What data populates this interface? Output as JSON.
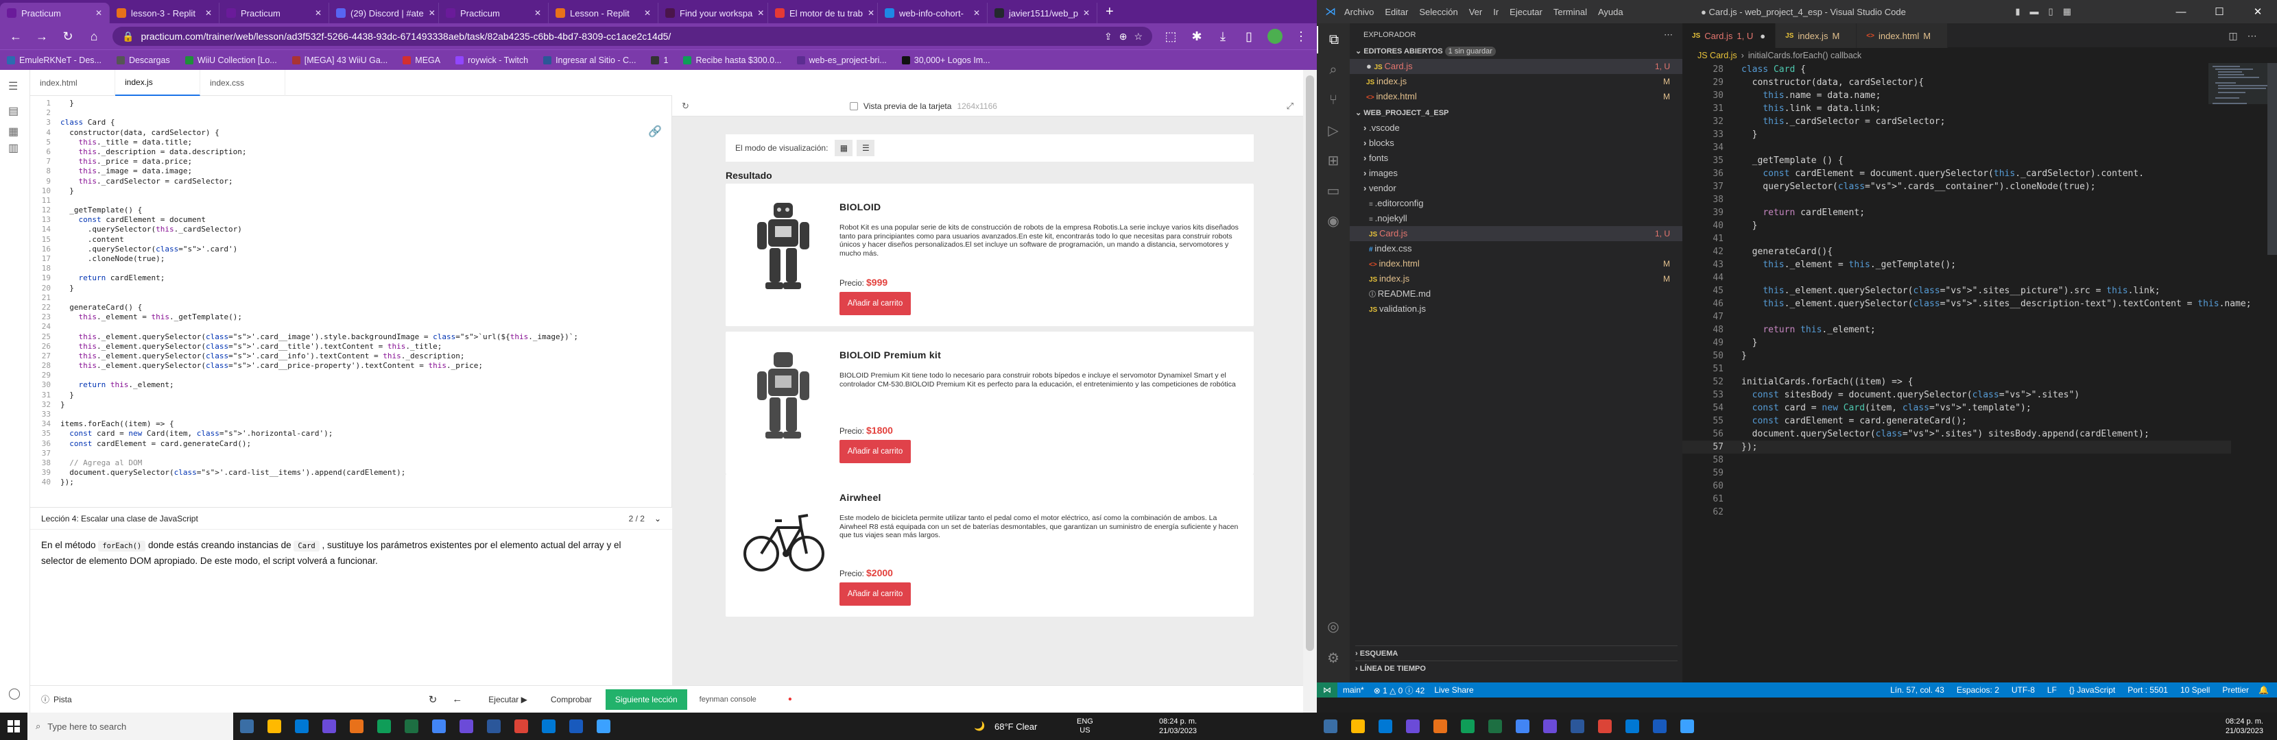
{
  "browser": {
    "tabs": [
      "Practicum",
      "lesson-3 - Replit",
      "Practicum",
      "(29) Discord | #ate",
      "Practicum",
      "Lesson - Replit",
      "Find your workspa",
      "El motor de tu trab",
      "web-info-cohort-",
      "javier1511/web_p"
    ],
    "new_tab": "+",
    "url": "practicum.com/trainer/web/lesson/ad3f532f-5266-4438-93dc-671493338aeb/task/82ab4235-c6bb-4bd7-8309-cc1ace2c14d5/",
    "bookmarks": [
      "EmuleRKNeT - Des...",
      "Descargas",
      "WiiU Collection [Lo...",
      "[MEGA] 43 WiiU Ga...",
      "MEGA",
      "roywick - Twitch",
      "Ingresar al Sitio - C...",
      "1",
      "Recibe hasta $300.0...",
      "web-es_project-bri...",
      "30,000+ Logos Im..."
    ],
    "bm_colors": [
      "#2c6bb0",
      "#555",
      "#1f8f3a",
      "#a33",
      "#d32f2f",
      "#9146ff",
      "#2b5797",
      "#333",
      "#0f9d58",
      "#5c2d91",
      "#111"
    ]
  },
  "practicum": {
    "editor_tabs": [
      "index.html",
      "index.js",
      "index.css"
    ],
    "code": [
      {
        "n": "",
        "t": "  }"
      },
      {
        "n": "",
        "t": ""
      },
      {
        "n": "",
        "t": "class Card {"
      },
      {
        "n": "",
        "t": "  constructor(data, cardSelector) {"
      },
      {
        "n": "",
        "t": "    this._title = data.title;"
      },
      {
        "n": "",
        "t": "    this._description = data.description;"
      },
      {
        "n": "",
        "t": "    this._price = data.price;"
      },
      {
        "n": "",
        "t": "    this._image = data.image;"
      },
      {
        "n": "",
        "t": "    this._cardSelector = cardSelector;"
      },
      {
        "n": "",
        "t": "  }"
      },
      {
        "n": "",
        "t": ""
      },
      {
        "n": "",
        "t": "  _getTemplate() {"
      },
      {
        "n": "",
        "t": "    const cardElement = document"
      },
      {
        "n": "",
        "t": "      .querySelector(this._cardSelector)"
      },
      {
        "n": "",
        "t": "      .content"
      },
      {
        "n": "",
        "t": "      .querySelector('.card')"
      },
      {
        "n": "",
        "t": "      .cloneNode(true);"
      },
      {
        "n": "",
        "t": ""
      },
      {
        "n": "",
        "t": "    return cardElement;"
      },
      {
        "n": "",
        "t": "  }"
      },
      {
        "n": "",
        "t": ""
      },
      {
        "n": "",
        "t": "  generateCard() {"
      },
      {
        "n": "",
        "t": "    this._element = this._getTemplate();"
      },
      {
        "n": "",
        "t": ""
      },
      {
        "n": "",
        "t": "    this._element.querySelector('.card__image').style.backgroundImage = `url(${this._image})`;"
      },
      {
        "n": "",
        "t": "    this._element.querySelector('.card__title').textContent = this._title;"
      },
      {
        "n": "",
        "t": "    this._element.querySelector('.card__info').textContent = this._description;"
      },
      {
        "n": "",
        "t": "    this._element.querySelector('.card__price-property').textContent = this._price;"
      },
      {
        "n": "",
        "t": ""
      },
      {
        "n": "",
        "t": "    return this._element;"
      },
      {
        "n": "",
        "t": "  }"
      },
      {
        "n": "",
        "t": "}"
      },
      {
        "n": "",
        "t": ""
      },
      {
        "n": "",
        "t": "items.forEach((item) => {"
      },
      {
        "n": "",
        "t": "  const card = new Card(item, '.horizontal-card');"
      },
      {
        "n": "",
        "t": "  const cardElement = card.generateCard();"
      },
      {
        "n": "",
        "t": ""
      },
      {
        "n": "",
        "t": "  // Agrega al DOM"
      },
      {
        "n": "",
        "t": "  document.querySelector('.card-list__items').append(cardElement);"
      },
      {
        "n": "",
        "t": "});"
      }
    ],
    "lesson_title": "Lección 4: Escalar una clase de JavaScript",
    "lesson_pager": "2 / 2",
    "lesson_text_1": "En el método",
    "lesson_code_1": "forEach()",
    "lesson_text_2": "donde estás creando instancias de",
    "lesson_code_2": "Card",
    "lesson_text_3": ", sustituye los parámetros existentes por el elemento actual del array y el selector de elemento DOM apropiado. De este modo, el script volverá a funcionar.",
    "preview_label": "Vista previa de la tarjeta",
    "preview_size": "1264x1166",
    "view_mode_label": "El modo de visualización:",
    "result_label": "Resultado",
    "cards": [
      {
        "title": "BIOLOID",
        "desc": "Robot Kit es una popular serie de kits de construcción de robots de la empresa Robotis.La serie incluye varios kits diseñados tanto para principiantes como para usuarios avanzados.En este kit, encontrarás todo lo que necesitas para construir robots únicos y hacer diseños personalizados.El set incluye un software de programación, un mando a distancia, servomotores y mucho más.",
        "price_label": "Precio:",
        "price": "$999",
        "button": "Añadir al carrito"
      },
      {
        "title": "BIOLOID Premium kit",
        "desc": "BIOLOID Premium Kit tiene todo lo necesario para construir robots bípedos e incluye el servomotor Dynamixel Smart y el controlador CM-530.BIOLOID Premium Kit es perfecto para la educación, el entretenimiento y las competiciones de robótica",
        "price_label": "Precio:",
        "price": "$1800",
        "button": "Añadir al carrito"
      },
      {
        "title": "Airwheel",
        "desc": "Este modelo de bicicleta permite utilizar tanto el pedal como el motor eléctrico, así como la combinación de ambos. La Airwheel R8 está equipada con un set de baterías desmontables, que garantizan un suministro de energía suficiente y hacen que tus viajes sean más largos.",
        "price_label": "Precio:",
        "price": "$2000",
        "button": "Añadir al carrito"
      }
    ],
    "bottom": {
      "hint": "Pista",
      "run": "Ejecutar",
      "check": "Comprobar",
      "next": "Siguiente lección",
      "feynman": "feynman console"
    }
  },
  "vscode": {
    "title": "● Card.js - web_project_4_esp - Visual Studio Code",
    "menu": [
      "Archivo",
      "Editar",
      "Selección",
      "Ver",
      "Ir",
      "Ejecutar",
      "Terminal",
      "Ayuda"
    ],
    "explorer_title": "EXPLORADOR",
    "open_editors": "EDITORES ABIERTOS",
    "unsaved": "1 sin guardar",
    "open_files": [
      {
        "name": "Card.js",
        "badge": "1, U"
      },
      {
        "name": "index.js",
        "badge": "M"
      },
      {
        "name": "index.html",
        "badge": "M"
      }
    ],
    "project": "WEB_PROJECT_4_ESP",
    "tree": [
      {
        "name": ".vscode",
        "badge": "",
        "folder": true
      },
      {
        "name": "blocks",
        "badge": "",
        "folder": true
      },
      {
        "name": "fonts",
        "badge": "",
        "folder": true
      },
      {
        "name": "images",
        "badge": "",
        "folder": true
      },
      {
        "name": "vendor",
        "badge": "",
        "folder": true
      },
      {
        "name": ".editorconfig",
        "badge": "",
        "folder": false
      },
      {
        "name": ".nojekyll",
        "badge": "",
        "folder": false
      },
      {
        "name": "Card.js",
        "badge": "1, U",
        "folder": false
      },
      {
        "name": "index.css",
        "badge": "",
        "folder": false
      },
      {
        "name": "index.html",
        "badge": "M",
        "folder": false
      },
      {
        "name": "index.js",
        "badge": "M",
        "folder": false
      },
      {
        "name": "README.md",
        "badge": "",
        "folder": false
      },
      {
        "name": "validation.js",
        "badge": "",
        "folder": false
      }
    ],
    "outline": "ESQUEMA",
    "timeline": "LÍNEA DE TIEMPO",
    "tabs": [
      {
        "name": "Card.js",
        "badge": "1, U"
      },
      {
        "name": "index.js",
        "badge": "M"
      },
      {
        "name": "index.html",
        "badge": "M"
      }
    ],
    "breadcrumb": [
      "JS Card.js",
      "initialCards.forEach() callback"
    ],
    "code": [
      {
        "n": "28",
        "t": "class Card {"
      },
      {
        "n": "29",
        "t": "  constructor(data, cardSelector){"
      },
      {
        "n": "30",
        "t": "    this.name = data.name;"
      },
      {
        "n": "31",
        "t": "    this.link = data.link;"
      },
      {
        "n": "32",
        "t": "    this._cardSelector = cardSelector;"
      },
      {
        "n": "33",
        "t": "  }"
      },
      {
        "n": "34",
        "t": ""
      },
      {
        "n": "35",
        "t": "  _getTemplate () {"
      },
      {
        "n": "36",
        "t": "    const cardElement = document.querySelector(this._cardSelector).content."
      },
      {
        "n": "37",
        "t": "    querySelector(\".cards__container\").cloneNode(true);"
      },
      {
        "n": "38",
        "t": ""
      },
      {
        "n": "39",
        "t": "    return cardElement;"
      },
      {
        "n": "40",
        "t": "  }"
      },
      {
        "n": "41",
        "t": ""
      },
      {
        "n": "42",
        "t": "  generateCard(){"
      },
      {
        "n": "43",
        "t": "    this._element = this._getTemplate();"
      },
      {
        "n": "44",
        "t": ""
      },
      {
        "n": "45",
        "t": "    this._element.querySelector(\".sites__picture\").src = this.link;"
      },
      {
        "n": "46",
        "t": "    this._element.querySelector(\".sites__description-text\").textContent = this.name;"
      },
      {
        "n": "47",
        "t": ""
      },
      {
        "n": "48",
        "t": "    return this._element;"
      },
      {
        "n": "49",
        "t": "  }"
      },
      {
        "n": "50",
        "t": "}"
      },
      {
        "n": "51",
        "t": ""
      },
      {
        "n": "52",
        "t": "initialCards.forEach((item) => {"
      },
      {
        "n": "53",
        "t": "  const sitesBody = document.querySelector(\".sites\")"
      },
      {
        "n": "54",
        "t": "  const card = new Card(item, \".template\");"
      },
      {
        "n": "55",
        "t": "  const cardElement = card.generateCard();"
      },
      {
        "n": "56",
        "t": "  document.querySelector(\".sites\") sitesBody.append(cardElement);"
      },
      {
        "n": "57",
        "t": "});"
      },
      {
        "n": "58",
        "t": ""
      },
      {
        "n": "59",
        "t": ""
      },
      {
        "n": "60",
        "t": ""
      },
      {
        "n": "61",
        "t": ""
      },
      {
        "n": "62",
        "t": ""
      }
    ],
    "status_left": [
      "main*",
      "⊗ 1 △ 0 ⓘ 42",
      "Live Share"
    ],
    "status_right": [
      "Lín. 57, col. 43",
      "Espacios: 2",
      "UTF-8",
      "LF",
      "{} JavaScript",
      "Port : 5501",
      "10 Spell",
      "Prettier"
    ]
  },
  "taskbar": {
    "search": "Type here to search",
    "weather": "68°F  Clear",
    "lang1": "ENG",
    "lang2": "US",
    "time1": "08:24 p. m.",
    "date1": "21/03/2023",
    "time2": "08:24 p. m.",
    "date2": "21/03/2023"
  }
}
